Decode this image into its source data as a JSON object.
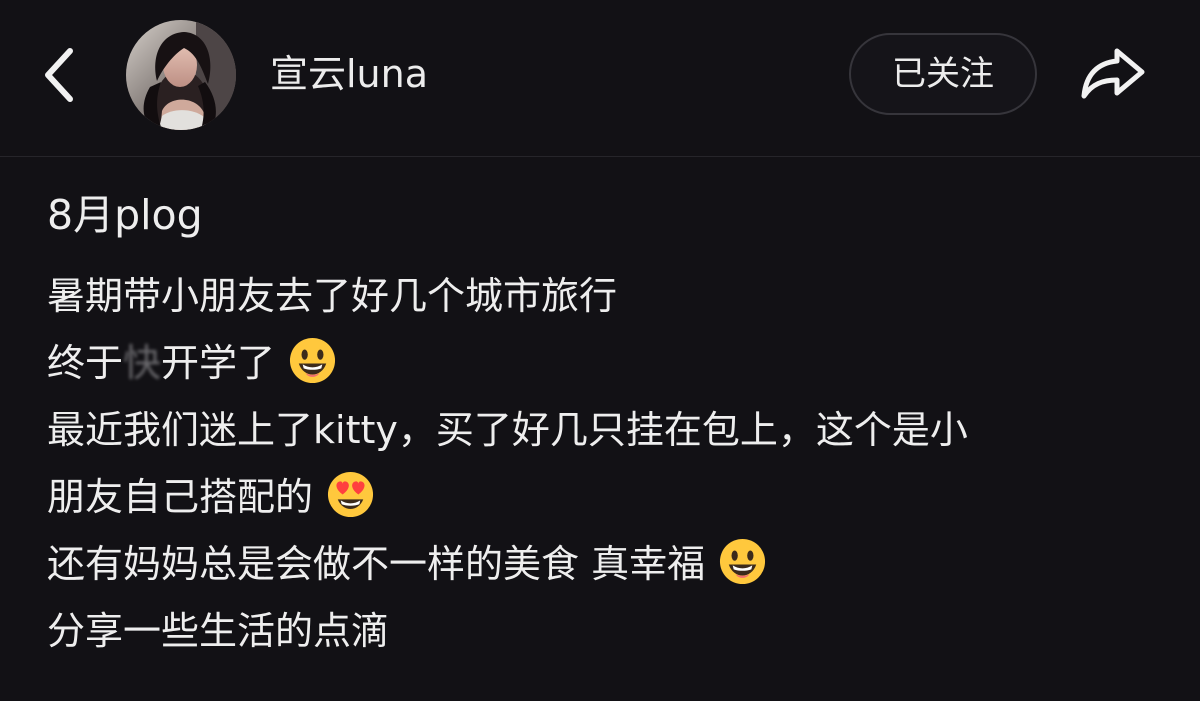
{
  "header": {
    "back_icon": "chevron-left-icon",
    "avatar_alt": "avatar",
    "username": "宣云luna",
    "follow_label": "已关注",
    "share_icon": "share-arrow-icon"
  },
  "post": {
    "title": "8月plog",
    "line1": "暑期带小朋友去了好几个城市旅行",
    "line2_a": "终于",
    "line2_b": "快",
    "line2_c": "开学了",
    "line3": "最近我们迷上了kitty，买了好几只挂在包上，这个是小",
    "line4": "朋友自己搭配的",
    "line5": "还有妈妈总是会做不一样的美食 真幸福",
    "line6": "分享一些生活的点滴"
  },
  "icons": {
    "line2_emoji": "grinning-face-icon",
    "line4_emoji": "heart-eyes-face-icon",
    "line5_emoji": "grinning-face-icon"
  },
  "colors": {
    "background": "#121115",
    "text": "#eeeeee",
    "follow_border": "#36353b",
    "emoji_yellow": "#ffc83d"
  }
}
